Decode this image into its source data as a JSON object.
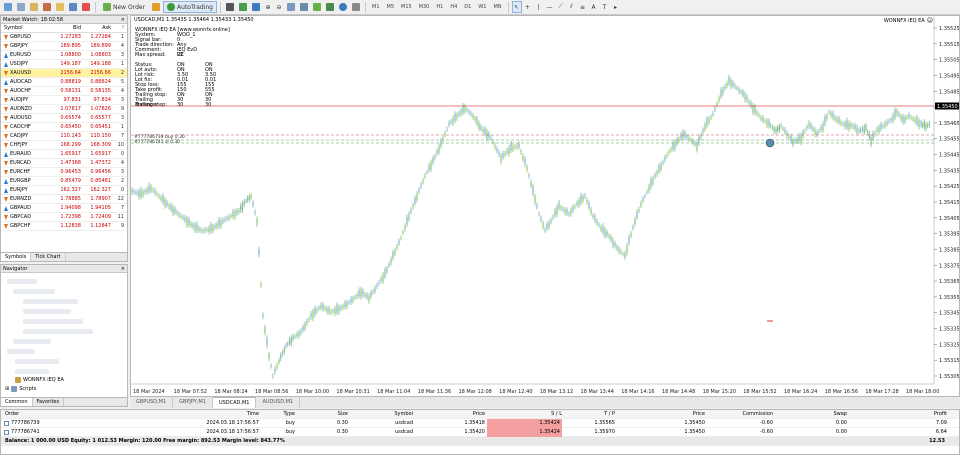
{
  "toolbar": {
    "new_order": "New Order",
    "autotrading": "AutoTrading",
    "timeframes": [
      "M1",
      "M5",
      "M15",
      "M30",
      "H1",
      "H4",
      "D1",
      "W1",
      "MN"
    ]
  },
  "market_watch": {
    "title": "Market Watch: 18:02:58",
    "headers": {
      "symbol": "Symbol",
      "bid": "Bid",
      "ask": "Ask",
      "spread": "!"
    },
    "rows": [
      {
        "symbol": "GBPUSD",
        "bid": "1.27283",
        "ask": "1.27284",
        "spread": "1",
        "dir": "dn"
      },
      {
        "symbol": "GBPJPY",
        "bid": "189.895",
        "ask": "189.899",
        "spread": "4",
        "dir": "dn"
      },
      {
        "symbol": "EURUSD",
        "bid": "1.08800",
        "ask": "1.08803",
        "spread": "3",
        "dir": "up"
      },
      {
        "symbol": "USDJPY",
        "bid": "149.187",
        "ask": "149.188",
        "spread": "1",
        "dir": "up"
      },
      {
        "symbol": "XAUUSD",
        "bid": "2156.64",
        "ask": "2156.66",
        "spread": "2",
        "dir": "dn",
        "highlight": true
      },
      {
        "symbol": "AUDCAD",
        "bid": "0.88819",
        "ask": "0.88824",
        "spread": "5",
        "dir": "up"
      },
      {
        "symbol": "AUDCHF",
        "bid": "0.58131",
        "ask": "0.58135",
        "spread": "4",
        "dir": "dn"
      },
      {
        "symbol": "AUDJPY",
        "bid": "97.831",
        "ask": "97.834",
        "spread": "3",
        "dir": "dn"
      },
      {
        "symbol": "AUDNZD",
        "bid": "1.07817",
        "ask": "1.07826",
        "spread": "9",
        "dir": "dn"
      },
      {
        "symbol": "AUDUSD",
        "bid": "0.65574",
        "ask": "0.65577",
        "spread": "3",
        "dir": "dn"
      },
      {
        "symbol": "CADCHF",
        "bid": "0.65450",
        "ask": "0.65451",
        "spread": "1",
        "dir": "dn"
      },
      {
        "symbol": "CADJPY",
        "bid": "110.143",
        "ask": "110.150",
        "spread": "7",
        "dir": "dn"
      },
      {
        "symbol": "CHFJPY",
        "bid": "168.299",
        "ask": "168.309",
        "spread": "10",
        "dir": "dn"
      },
      {
        "symbol": "EURAUD",
        "bid": "1.65917",
        "ask": "1.65917",
        "spread": "0",
        "dir": "up"
      },
      {
        "symbol": "EURCAD",
        "bid": "1.47368",
        "ask": "1.47372",
        "spread": "4",
        "dir": "dn"
      },
      {
        "symbol": "EURCHF",
        "bid": "0.96453",
        "ask": "0.96456",
        "spread": "3",
        "dir": "dn"
      },
      {
        "symbol": "EURGBP",
        "bid": "0.85479",
        "ask": "0.85481",
        "spread": "2",
        "dir": "up"
      },
      {
        "symbol": "EURJPY",
        "bid": "162.327",
        "ask": "162.327",
        "spread": "0",
        "dir": "up"
      },
      {
        "symbol": "EURNZD",
        "bid": "1.78885",
        "ask": "1.78907",
        "spread": "22",
        "dir": "dn"
      },
      {
        "symbol": "GBPAUD",
        "bid": "1.94098",
        "ask": "1.94105",
        "spread": "7",
        "dir": "up"
      },
      {
        "symbol": "GBPCAD",
        "bid": "1.72398",
        "ask": "1.72409",
        "spread": "11",
        "dir": "dn"
      },
      {
        "symbol": "GBPCHF",
        "bid": "1.12838",
        "ask": "1.12847",
        "spread": "9",
        "dir": "dn"
      }
    ],
    "tabs": [
      "Symbols",
      "Tick Chart"
    ]
  },
  "navigator": {
    "title": "Navigator",
    "item_ea": "WONNFX iEQ EA",
    "item_scripts": "Scripts",
    "tabs": [
      "Common",
      "Favorites"
    ]
  },
  "chart": {
    "title": "USDCAD,M1  1.35435 1.35464 1.35433 1.35450",
    "ea_name": "WONNFX iEQ EA",
    "info_header": "WONNFX iEQ EA [www.wonnfx.online]",
    "info_rows": [
      [
        "System:",
        "WOO_1"
      ],
      [
        "Signal bar:",
        "0"
      ],
      [
        "Trade direction:",
        "Any"
      ],
      [
        "Comment:",
        "iEQ EvD UC"
      ],
      [
        "Max spread:",
        "22"
      ],
      [
        "",
        ""
      ],
      [
        "Status:",
        "ON",
        "ON"
      ],
      [
        "Lot auto:",
        "ON",
        "ON"
      ],
      [
        "Lot risk:",
        "3.50",
        "3.50"
      ],
      [
        "Lot fix:",
        "0.01",
        "0.01"
      ],
      [
        "Stop loss:",
        "155",
        "155"
      ],
      [
        "Take profit:",
        "150",
        "555"
      ],
      [
        "Trailing stop:",
        "ON",
        "ON"
      ],
      [
        "Trailing distance:",
        "30",
        "30"
      ],
      [
        "Trailing step:",
        "30",
        "30"
      ]
    ],
    "order_label_1": "#777786739 buy 0.30",
    "order_label_2": "#777786741 sl 0.30",
    "price_labels": [
      "1.35525",
      "1.35515",
      "1.35505",
      "1.35495",
      "1.35485",
      "1.35475",
      "1.35465",
      "1.35455",
      "1.35445",
      "1.35435",
      "1.35425",
      "1.35415",
      "1.35405",
      "1.35395",
      "1.35385",
      "1.35375",
      "1.35365",
      "1.35355",
      "1.35345",
      "1.35335",
      "1.35325",
      "1.35315",
      "1.35305"
    ],
    "current_price": "1.35450",
    "time_labels": [
      "18 Mar 2024",
      "18 Mar 07:52",
      "18 Mar 08:24",
      "18 Mar 08:56",
      "18 Mar 10:00",
      "18 Mar 10:31",
      "18 Mar 11:04",
      "18 Mar 11:36",
      "18 Mar 12:08",
      "18 Mar 12:40",
      "18 Mar 13:12",
      "18 Mar 13:44",
      "18 Mar 14:16",
      "18 Mar 14:48",
      "18 Mar 15:20",
      "18 Mar 15:52",
      "18 Mar 16:24",
      "18 Mar 16:56",
      "18 Mar 17:28",
      "18 Mar 18:00"
    ],
    "tabs": [
      "GBPUSD,M1",
      "GBPJPY,M1",
      "USDCAD,M1",
      "AUDUSD,M1"
    ],
    "active_tab": 2,
    "bull_color": "#8cc46a",
    "bear_color": "#7ab4c8"
  },
  "terminal": {
    "headers": [
      "Order",
      "Time",
      "Type",
      "Size",
      "Symbol",
      "Price",
      "S / L",
      "T / P",
      "Price",
      "Commission",
      "Swap",
      "Profit"
    ],
    "rows": [
      [
        "777786739",
        "2024.03.18 17:56:57",
        "buy",
        "0.30",
        "usdcad",
        "1.35418",
        "1.35424",
        "1.35565",
        "1.35450",
        "-0.60",
        "0.00",
        "7.09"
      ],
      [
        "777786741",
        "2024.03.18 17:56:57",
        "buy",
        "0.30",
        "usdcad",
        "1.35420",
        "1.35424",
        "1.35970",
        "1.35450",
        "-0.60",
        "0.00",
        "6.64"
      ]
    ],
    "balance_line": "Balance: 1 000.00 USD  Equity: 1 012.53  Margin: 120.00  Free margin: 892.53  Margin level: 843.77%",
    "total_profit": "12.53"
  }
}
